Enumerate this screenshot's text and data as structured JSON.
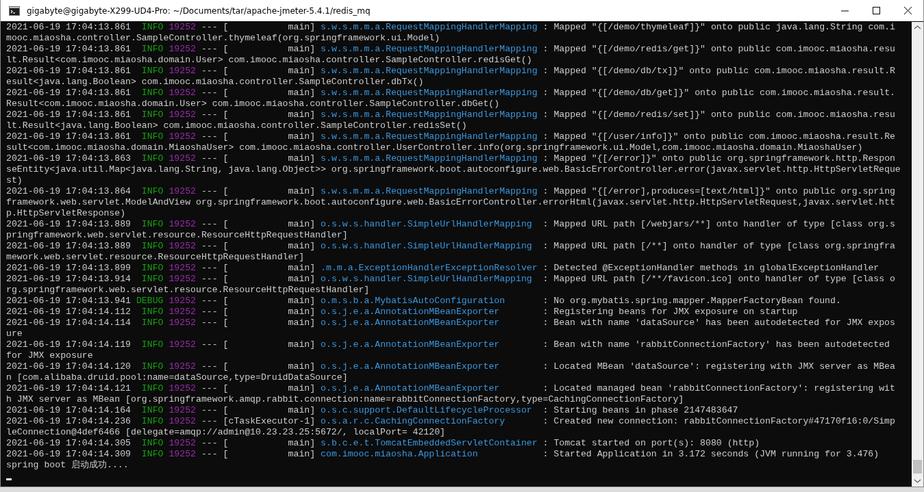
{
  "window": {
    "title": "gigabyte@gigabyte-X299-UD4-Pro: ~/Documents/tar/apache-jmeter-5.4.1/redis_mq"
  },
  "log": [
    {
      "time": "2021-06-19 17:04:13.861",
      "level": "INFO",
      "pid": "19252",
      "separator": "---",
      "thread": "[           main]",
      "logger": "s.w.s.m.m.a.RequestMappingHandlerMapping",
      "message": ": Mapped \"{[/demo/thymeleaf]}\" onto public java.lang.String com.imooc.miaosha.controller.SampleController.thymeleaf(org.springframework.ui.Model)"
    },
    {
      "time": "2021-06-19 17:04:13.861",
      "level": "INFO",
      "pid": "19252",
      "separator": "---",
      "thread": "[           main]",
      "logger": "s.w.s.m.m.a.RequestMappingHandlerMapping",
      "message": ": Mapped \"{[/demo/redis/get]}\" onto public com.imooc.miaosha.result.Result<com.imooc.miaosha.domain.User> com.imooc.miaosha.controller.SampleController.redisGet()"
    },
    {
      "time": "2021-06-19 17:04:13.861",
      "level": "INFO",
      "pid": "19252",
      "separator": "---",
      "thread": "[           main]",
      "logger": "s.w.s.m.m.a.RequestMappingHandlerMapping",
      "message": ": Mapped \"{[/demo/db/tx]}\" onto public com.imooc.miaosha.result.Result<java.lang.Boolean> com.imooc.miaosha.controller.SampleController.dbTx()"
    },
    {
      "time": "2021-06-19 17:04:13.861",
      "level": "INFO",
      "pid": "19252",
      "separator": "---",
      "thread": "[           main]",
      "logger": "s.w.s.m.m.a.RequestMappingHandlerMapping",
      "message": ": Mapped \"{[/demo/db/get]}\" onto public com.imooc.miaosha.result.Result<com.imooc.miaosha.domain.User> com.imooc.miaosha.controller.SampleController.dbGet()"
    },
    {
      "time": "2021-06-19 17:04:13.861",
      "level": "INFO",
      "pid": "19252",
      "separator": "---",
      "thread": "[           main]",
      "logger": "s.w.s.m.m.a.RequestMappingHandlerMapping",
      "message": ": Mapped \"{[/demo/redis/set]}\" onto public com.imooc.miaosha.result.Result<java.lang.Boolean> com.imooc.miaosha.controller.SampleController.redisSet()"
    },
    {
      "time": "2021-06-19 17:04:13.861",
      "level": "INFO",
      "pid": "19252",
      "separator": "---",
      "thread": "[           main]",
      "logger": "s.w.s.m.m.a.RequestMappingHandlerMapping",
      "message": ": Mapped \"{[/user/info]}\" onto public com.imooc.miaosha.result.Result<com.imooc.miaosha.domain.MiaoshaUser> com.imooc.miaosha.controller.UserController.info(org.springframework.ui.Model,com.imooc.miaosha.domain.MiaoshaUser)"
    },
    {
      "time": "2021-06-19 17:04:13.863",
      "level": "INFO",
      "pid": "19252",
      "separator": "---",
      "thread": "[           main]",
      "logger": "s.w.s.m.m.a.RequestMappingHandlerMapping",
      "message": ": Mapped \"{[/error]}\" onto public org.springframework.http.ResponseEntity<java.util.Map<java.lang.String, java.lang.Object>> org.springframework.boot.autoconfigure.web.BasicErrorController.error(javax.servlet.http.HttpServletRequest)"
    },
    {
      "time": "2021-06-19 17:04:13.864",
      "level": "INFO",
      "pid": "19252",
      "separator": "---",
      "thread": "[           main]",
      "logger": "s.w.s.m.m.a.RequestMappingHandlerMapping",
      "message": ": Mapped \"{[/error],produces=[text/html]}\" onto public org.springframework.web.servlet.ModelAndView org.springframework.boot.autoconfigure.web.BasicErrorController.errorHtml(javax.servlet.http.HttpServletRequest,javax.servlet.http.HttpServletResponse)"
    },
    {
      "time": "2021-06-19 17:04:13.889",
      "level": "INFO",
      "pid": "19252",
      "separator": "---",
      "thread": "[           main]",
      "logger": "o.s.w.s.handler.SimpleUrlHandlerMapping",
      "message": ": Mapped URL path [/webjars/**] onto handler of type [class org.springframework.web.servlet.resource.ResourceHttpRequestHandler]"
    },
    {
      "time": "2021-06-19 17:04:13.889",
      "level": "INFO",
      "pid": "19252",
      "separator": "---",
      "thread": "[           main]",
      "logger": "o.s.w.s.handler.SimpleUrlHandlerMapping",
      "message": ": Mapped URL path [/**] onto handler of type [class org.springframework.web.servlet.resource.ResourceHttpRequestHandler]"
    },
    {
      "time": "2021-06-19 17:04:13.899",
      "level": "INFO",
      "pid": "19252",
      "separator": "---",
      "thread": "[           main]",
      "logger": ".m.m.a.ExceptionHandlerExceptionResolver",
      "message": ": Detected @ExceptionHandler methods in globalExceptionHandler"
    },
    {
      "time": "2021-06-19 17:04:13.914",
      "level": "INFO",
      "pid": "19252",
      "separator": "---",
      "thread": "[           main]",
      "logger": "o.s.w.s.handler.SimpleUrlHandlerMapping",
      "message": ": Mapped URL path [/**/favicon.ico] onto handler of type [class org.springframework.web.servlet.resource.ResourceHttpRequestHandler]"
    },
    {
      "time": "2021-06-19 17:04:13.941",
      "level": "DEBUG",
      "pid": "19252",
      "separator": "---",
      "thread": "[           main]",
      "logger": "o.m.s.b.a.MybatisAutoConfiguration",
      "message": ": No org.mybatis.spring.mapper.MapperFactoryBean found."
    },
    {
      "time": "2021-06-19 17:04:14.112",
      "level": "INFO",
      "pid": "19252",
      "separator": "---",
      "thread": "[           main]",
      "logger": "o.s.j.e.a.AnnotationMBeanExporter",
      "message": ": Registering beans for JMX exposure on startup"
    },
    {
      "time": "2021-06-19 17:04:14.114",
      "level": "INFO",
      "pid": "19252",
      "separator": "---",
      "thread": "[           main]",
      "logger": "o.s.j.e.a.AnnotationMBeanExporter",
      "message": ": Bean with name 'dataSource' has been autodetected for JMX exposure"
    },
    {
      "time": "2021-06-19 17:04:14.119",
      "level": "INFO",
      "pid": "19252",
      "separator": "---",
      "thread": "[           main]",
      "logger": "o.s.j.e.a.AnnotationMBeanExporter",
      "message": ": Bean with name 'rabbitConnectionFactory' has been autodetected for JMX exposure"
    },
    {
      "time": "2021-06-19 17:04:14.120",
      "level": "INFO",
      "pid": "19252",
      "separator": "---",
      "thread": "[           main]",
      "logger": "o.s.j.e.a.AnnotationMBeanExporter",
      "message": ": Located MBean 'dataSource': registering with JMX server as MBean [com.alibaba.druid.pool:name=dataSource,type=DruidDataSource]"
    },
    {
      "time": "2021-06-19 17:04:14.121",
      "level": "INFO",
      "pid": "19252",
      "separator": "---",
      "thread": "[           main]",
      "logger": "o.s.j.e.a.AnnotationMBeanExporter",
      "message": ": Located managed bean 'rabbitConnectionFactory': registering with JMX server as MBean [org.springframework.amqp.rabbit.connection:name=rabbitConnectionFactory,type=CachingConnectionFactory]"
    },
    {
      "time": "2021-06-19 17:04:14.164",
      "level": "INFO",
      "pid": "19252",
      "separator": "---",
      "thread": "[           main]",
      "logger": "o.s.c.support.DefaultLifecycleProcessor",
      "message": ": Starting beans in phase 2147483647"
    },
    {
      "time": "2021-06-19 17:04:14.236",
      "level": "INFO",
      "pid": "19252",
      "separator": "---",
      "thread": "[cTaskExecutor-1]",
      "logger": "o.s.a.r.c.CachingConnectionFactory",
      "message": ": Created new connection: rabbitConnectionFactory#47170f16:0/SimpleConnection@4def6466 [delegate=amqp://admin@10.23.23.25:5672/, localPort= 42120]"
    },
    {
      "time": "2021-06-19 17:04:14.305",
      "level": "INFO",
      "pid": "19252",
      "separator": "---",
      "thread": "[           main]",
      "logger": "s.b.c.e.t.TomcatEmbeddedServletContainer",
      "message": ": Tomcat started on port(s): 8080 (http)"
    },
    {
      "time": "2021-06-19 17:04:14.309",
      "level": "INFO",
      "pid": "19252",
      "separator": "---",
      "thread": "[           main]",
      "logger": "com.imooc.miaosha.Application",
      "message": ": Started Application in 3.172 seconds (JVM running for 3.476)"
    }
  ],
  "output": [
    "spring boot 启动成功...."
  ]
}
